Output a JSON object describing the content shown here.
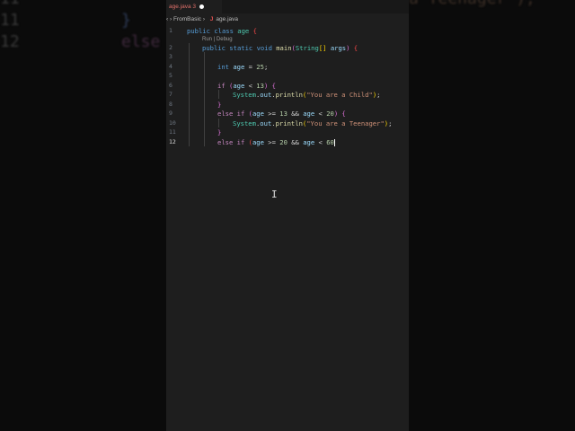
{
  "background": {
    "line_numbers": [
      "11",
      "12"
    ],
    "left_code": [
      "}",
      "else"
    ],
    "right_code": "a Teenager\");"
  },
  "tab": {
    "label": "age.java",
    "problems": "3"
  },
  "breadcrumb": {
    "folder": "FromBasic",
    "file_icon": "J",
    "file": "age.java"
  },
  "codelens": "Run | Debug",
  "line_numbers": [
    "1",
    "2",
    "3",
    "4",
    "5",
    "6",
    "7",
    "8",
    "9",
    "10",
    "11",
    "12"
  ],
  "code": {
    "l1": [
      "public",
      "class",
      "age",
      "{"
    ],
    "l2": [
      "public",
      "static",
      "void",
      "main",
      "(",
      "String",
      "[]",
      "args",
      ")",
      "{"
    ],
    "l4": [
      "int",
      "age",
      "=",
      "25",
      ";"
    ],
    "l6": [
      "if",
      "(",
      "age",
      "<",
      "13",
      ")",
      "{"
    ],
    "l7": [
      "System",
      ".",
      "out",
      ".",
      "println",
      "(",
      "\"You are a Child\"",
      ")",
      ";"
    ],
    "l8": "}",
    "l9": [
      "else",
      "if",
      "(",
      "age",
      ">=",
      "13",
      "&&",
      "age",
      "<",
      "20",
      ")",
      "{"
    ],
    "l10": [
      "System",
      ".",
      "out",
      ".",
      "println",
      "(",
      "\"You are a Teenager\"",
      ")",
      ";"
    ],
    "l11": "}",
    "l12": [
      "else",
      "if",
      "(",
      "age",
      ">=",
      "20",
      "&&",
      "age",
      "<",
      "60"
    ]
  }
}
